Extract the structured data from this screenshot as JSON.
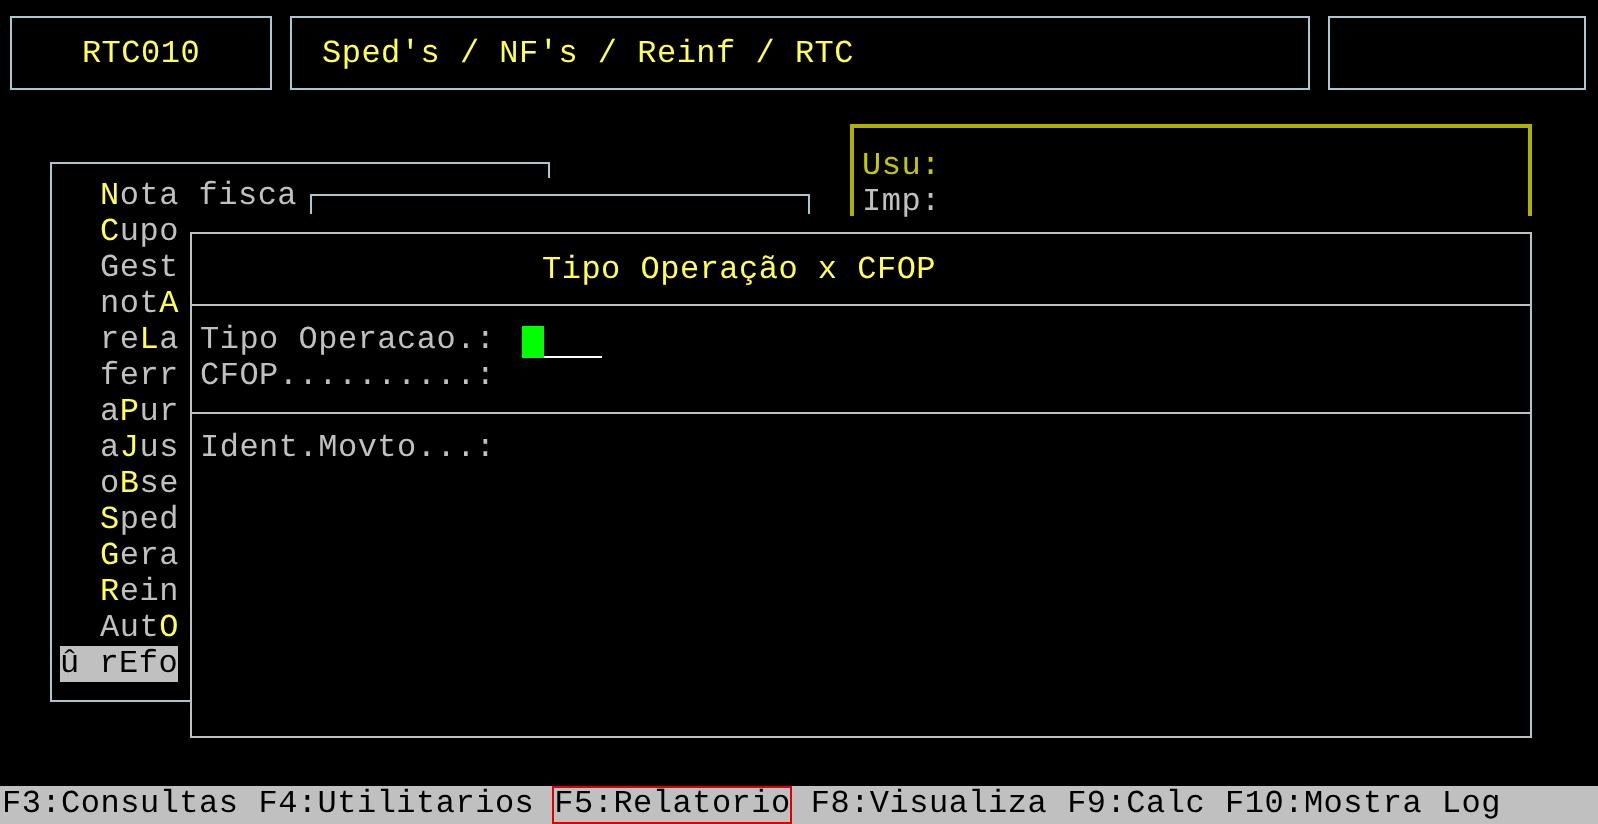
{
  "header": {
    "program_code": "RTC010",
    "breadcrumb": "Sped's / NF's / Reinf / RTC"
  },
  "info_panel": {
    "labels": [
      "Usu:",
      "Imp:"
    ]
  },
  "menu": {
    "items": [
      {
        "key": "N",
        "after": "ota fisca",
        "selected": false
      },
      {
        "key": "C",
        "after": "upo",
        "selected": false
      },
      {
        "before": "Gest",
        "selected": false
      },
      {
        "before": "not",
        "key": "A",
        "selected": false
      },
      {
        "before": "re",
        "key": "L",
        "after": "a",
        "selected": false
      },
      {
        "before": "ferr",
        "selected": false
      },
      {
        "before": "a",
        "key": "P",
        "after": "ur",
        "selected": false
      },
      {
        "before": "a",
        "key": "J",
        "after": "us",
        "selected": false
      },
      {
        "before": "o",
        "key": "B",
        "after": "se",
        "selected": false
      },
      {
        "key": "S",
        "after": "ped",
        "selected": false
      },
      {
        "key": "G",
        "after": "era",
        "selected": false
      },
      {
        "key": "R",
        "after": "ein",
        "selected": false
      },
      {
        "before": "Aut",
        "key": "O",
        "selected": false
      },
      {
        "before": "û rEfo",
        "selected": true
      }
    ]
  },
  "dialog": {
    "title": "Tipo Operação x CFOP",
    "fields": [
      {
        "label": "Tipo Operacao.:",
        "focused": true
      },
      {
        "label": "CFOP..........:",
        "focused": false
      }
    ],
    "fields_2": [
      {
        "label": "Ident.Movto...:"
      }
    ]
  },
  "function_keys": [
    {
      "label": "F3:Consultas",
      "selected": false
    },
    {
      "label": "F4:Utilitarios",
      "selected": false
    },
    {
      "label": "F5:Relatorio",
      "selected": true
    },
    {
      "label": "F8:Visualiza",
      "selected": false
    },
    {
      "label": "F9:Calc",
      "selected": false
    },
    {
      "label": "F10:Mostra Log",
      "selected": false
    }
  ]
}
